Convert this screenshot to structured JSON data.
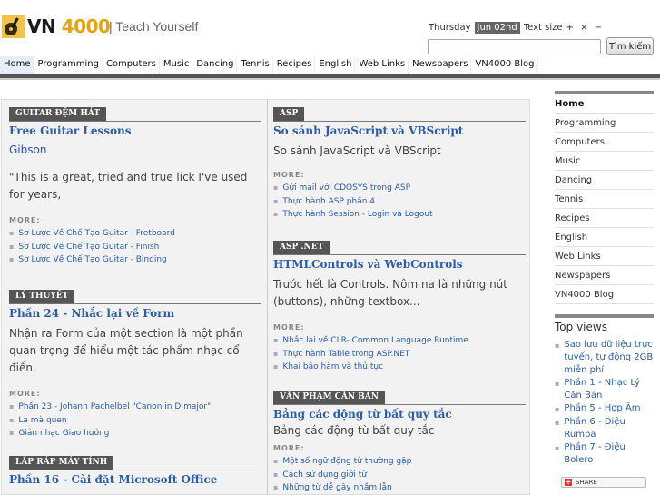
{
  "header": {
    "logo_text": "VN",
    "logo_num": "4000",
    "tagline": "| Teach Yourself",
    "day": "Thursday",
    "date": "Jun 02nd",
    "text_size_label": "Text size",
    "text_size_controls": "+ × −",
    "search_placeholder": "",
    "search_button": "Tìm kiếm"
  },
  "nav": [
    "Home",
    "Programming",
    "Computers",
    "Music",
    "Dancing",
    "Tennis",
    "Recipes",
    "English",
    "Web Links",
    "Newspapers",
    "VN4000 Blog"
  ],
  "left": [
    {
      "category": "GUITAR ĐỆM HÁT",
      "title": "Free Guitar Lessons",
      "link": "Gibson",
      "body": "\"This is a great, tried and true lick I've used for years,",
      "more_label": "MORE:",
      "more": [
        "Sơ Lược Về Chế Tạo Guitar - Fretboard",
        "Sơ Lược Về Chế Tạo Guitar - Finish",
        "Sơ Lược Về Chế Tạo Guitar - Binding"
      ]
    },
    {
      "category": "LÝ THUYẾT",
      "title": "Phần 24 - Nhắc lại về Form",
      "body": "Nhận ra Form của một section là một phần quan trọng để hiểu một tác phẩm nhạc cổ điển.",
      "more_label": "MORE:",
      "more": [
        "Phần 23 - Johann Pachelbel \"Canon in D major\"",
        "Lạ mà quen",
        "Giản nhạc Giao hưởng"
      ]
    },
    {
      "category": "LẮP RÁP MÁY TÍNH",
      "title": "Phần 16 - Cài đặt Microsoft Office"
    }
  ],
  "right": [
    {
      "category": "ASP",
      "title": "So sánh JavaScript và VBScript",
      "body": "So sánh JavaScript và VBScript",
      "more_label": "MORE:",
      "more": [
        "Gửi mail với CDOSYS trong ASP",
        "Thực hành ASP phần 4",
        "Thực hành Session - Login và Logout"
      ]
    },
    {
      "category": "ASP .NET",
      "title": "HTMLControls và WebControls",
      "body": "Trước hết là Controls. Nôm na là những nút (buttons), những textbox...",
      "more_label": "MORE:",
      "more": [
        "Nhắc lại về CLR- Common Language Runtime",
        "Thực hành Table trong ASP.NET",
        "Khai báo hàm và thủ tục"
      ]
    },
    {
      "category": "VĂN PHẠM CĂN BẢN",
      "title": "Bảng các động từ bất quy tắc",
      "body": "Bảng các động từ bất quy tắc",
      "more_label": "MORE:",
      "more": [
        "Một số ngữ động từ thường gặp",
        "Cách sử dụng giới từ",
        "Những từ dễ gây nhầm lẫn"
      ]
    }
  ],
  "sidebar": {
    "items": [
      "Home",
      "Programming",
      "Computers",
      "Music",
      "Dancing",
      "Tennis",
      "Recipes",
      "English",
      "Web Links",
      "Newspapers",
      "VN4000 Blog"
    ],
    "topviews_title": "Top views",
    "topviews": [
      "Sao lưu dữ liệu trực tuyến, tự động 2GB miễn phí",
      "Phần 1 - Nhạc Lý Căn Bản",
      "Phần 5 - Hợp Âm",
      "Phần 6 - Điệu Rumba",
      "Phần 7 - Điệu Bolero"
    ],
    "share_label": "SHARE"
  },
  "colors": {
    "accent": "#2a5db0",
    "tag_bg": "#555555",
    "logo_orange": "#e8a20c"
  }
}
